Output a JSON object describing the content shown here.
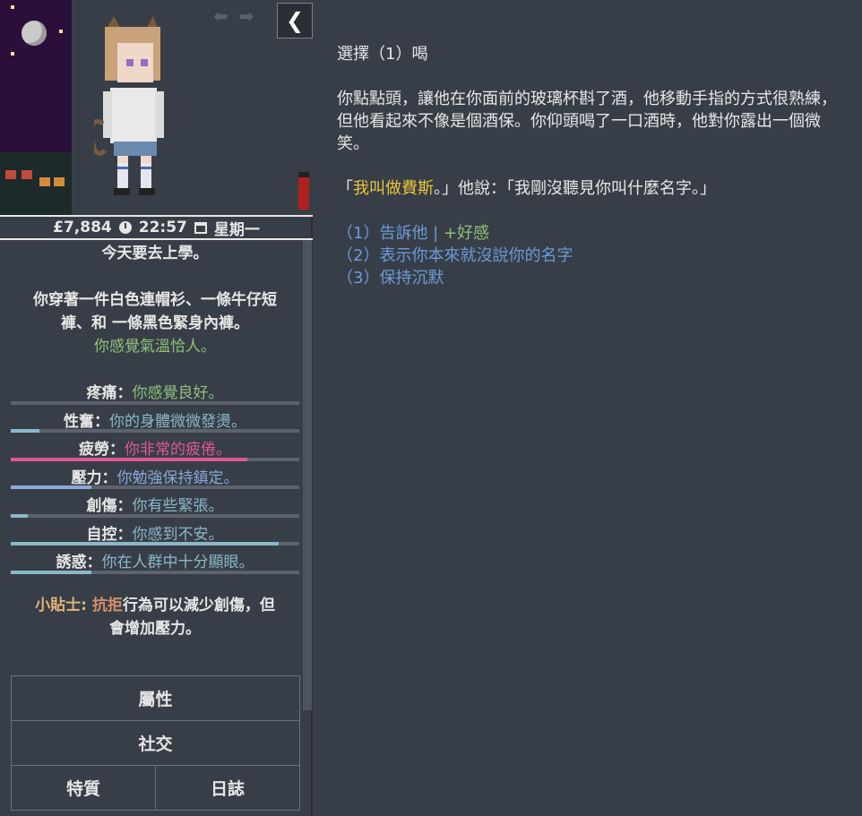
{
  "sidebar": {
    "status": {
      "money": "£7,884",
      "time": "22:57",
      "day": "星期一"
    },
    "intro_line": "今天要去上學。",
    "outfit_line1": "你穿著一件白色連帽衫、一條牛仔短",
    "outfit_line2": "褲、和 一條黑色緊身內褲。",
    "temperature": "你感覺氣溫恰人。",
    "stats": [
      {
        "label": "疼痛：",
        "value": "你感覺良好。",
        "color": "#8fc27a",
        "fill": 0
      },
      {
        "label": "性奮：",
        "value": "你的身體微微發燙。",
        "color": "#8ab8c9",
        "fill": 0.1,
        "bar_color": "#8ab8c9"
      },
      {
        "label": "疲勞：",
        "value": "你非常的疲倦。",
        "color": "#e0579a",
        "fill": 0.82,
        "bar_color": "#e0579a"
      },
      {
        "label": "壓力：",
        "value": "你勉強保持鎮定。",
        "color": "#88a8d8",
        "fill": 0.28,
        "bar_color": "#88a8d8"
      },
      {
        "label": "創傷：",
        "value": "你有些緊張。",
        "color": "#8ab8c9",
        "fill": 0.06,
        "bar_color": "#8ab8c9"
      },
      {
        "label": "自控：",
        "value": "你感到不安。",
        "color": "#8ab8c9",
        "fill": 0.93,
        "bar_color": "#8ab8c9"
      },
      {
        "label": "誘惑：",
        "value": "你在人群中十分顯眼。",
        "color": "#8ab8c9",
        "fill": 0.28,
        "bar_color": "#8ab8c9"
      }
    ],
    "tip_prefix": "小貼士:",
    "tip_keyword": "抗拒",
    "tip_rest": "行為可以減少創傷，但",
    "tip_line2": "會增加壓力。",
    "menu": {
      "attributes": "屬性",
      "social": "社交",
      "traits": "特質",
      "journal": "日誌"
    }
  },
  "main": {
    "heading": "選擇（1）喝",
    "paragraph": "你點點頭，讓他在你面前的玻璃杯斟了酒，他移動手指的方式很熟練，但他看起來不像是個酒保。你仰頭喝了一口酒時，他對你露出一個微笑。",
    "speech_open": "「",
    "speech_quote": "我叫做費斯",
    "speech_rest": "。」他說：「我剛沒聽見你叫什麼名字。」",
    "choices": [
      {
        "text": "（1）告訴他",
        "suffix": "+好感"
      },
      {
        "text": "（2）表示你本來就沒說你的名字"
      },
      {
        "text": "（3）保持沉默"
      }
    ]
  }
}
